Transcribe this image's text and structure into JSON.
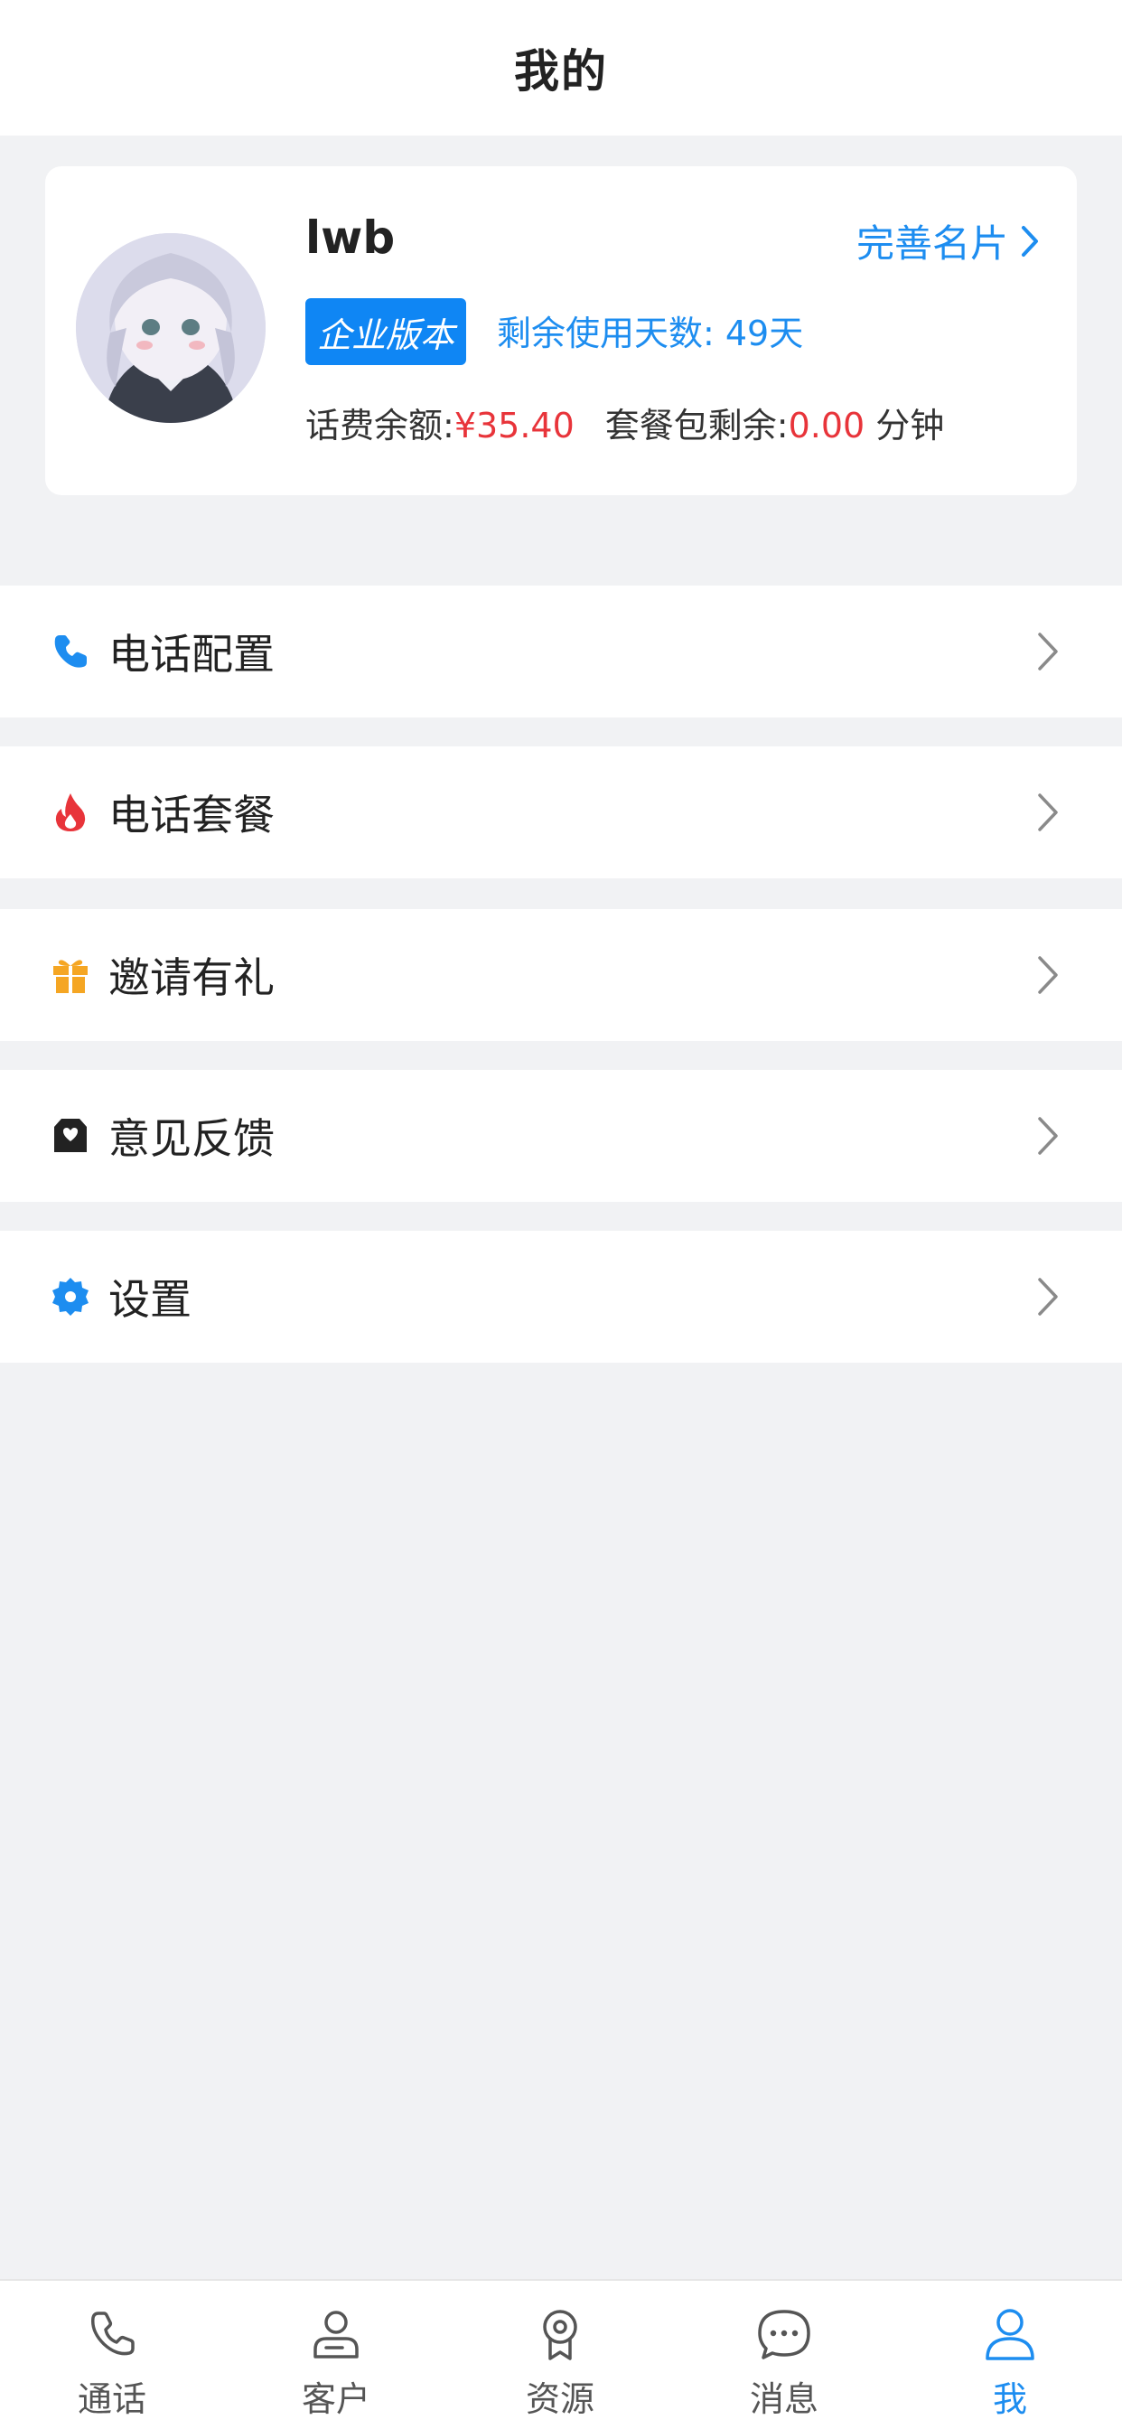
{
  "header": {
    "title": "我的"
  },
  "profile": {
    "username": "lwb",
    "edit_card_label": "完善名片",
    "edition_badge": "企业版本",
    "days_left": "剩余使用天数: 49天",
    "balance_label": "话费余额:",
    "balance_value": "¥35.40",
    "package_label": "套餐包剩余:",
    "package_value": "0.00",
    "package_unit": "分钟"
  },
  "menu": [
    {
      "label": "电话配置",
      "icon": "phone-icon",
      "color": "#1d8df0"
    },
    {
      "label": "电话套餐",
      "icon": "flame-icon",
      "color": "#e8343a"
    },
    {
      "label": "邀请有礼",
      "icon": "gift-icon",
      "color": "#f5a623"
    },
    {
      "label": "意见反馈",
      "icon": "feedback-mail-icon",
      "color": "#222222"
    },
    {
      "label": "设置",
      "icon": "settings-gear-icon",
      "color": "#1d8df0"
    }
  ],
  "tabbar": {
    "items": [
      {
        "label": "通话",
        "icon": "phone-call-icon"
      },
      {
        "label": "客户",
        "icon": "customer-icon"
      },
      {
        "label": "资源",
        "icon": "resource-badge-icon"
      },
      {
        "label": "消息",
        "icon": "message-bubble-icon"
      },
      {
        "label": "我",
        "icon": "me-user-icon"
      }
    ],
    "active": "我"
  },
  "colors": {
    "accent": "#1d8df0",
    "price_red": "#e8343a",
    "page_bg": "#f1f2f4"
  }
}
